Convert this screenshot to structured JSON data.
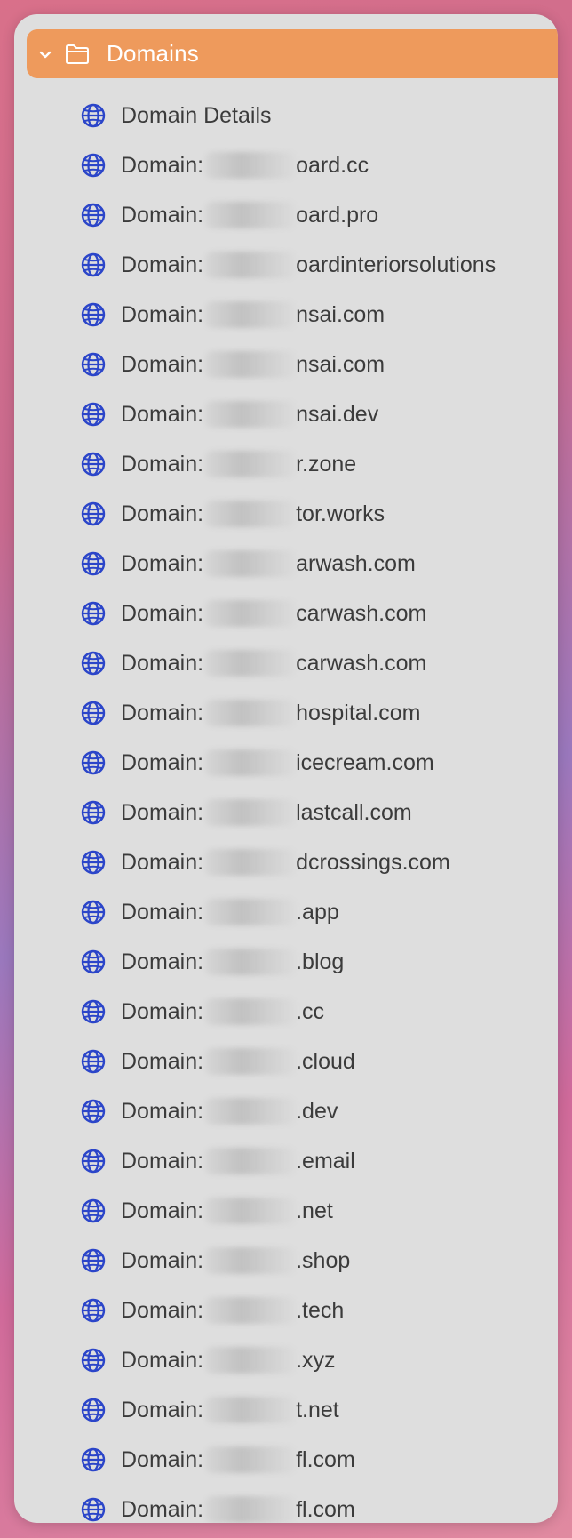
{
  "sidebar": {
    "folder": {
      "label": "Domains",
      "expanded": true,
      "icon": "folder-icon",
      "chevron_icon": "chevron-down-icon",
      "accent_color": "#ee9a5c"
    },
    "item_icon": "globe-icon",
    "icon_color": "#2b45c9",
    "items": [
      {
        "prefix": "Domain Details",
        "suffix": "",
        "redacted": false
      },
      {
        "prefix": "Domain:",
        "suffix": "oard.cc",
        "redacted": true
      },
      {
        "prefix": "Domain:",
        "suffix": "oard.pro",
        "redacted": true
      },
      {
        "prefix": "Domain:",
        "suffix": "oardinteriorsolutions",
        "redacted": true
      },
      {
        "prefix": "Domain:",
        "suffix": "nsai.com",
        "redacted": true
      },
      {
        "prefix": "Domain:",
        "suffix": "nsai.com",
        "redacted": true
      },
      {
        "prefix": "Domain:",
        "suffix": "nsai.dev",
        "redacted": true
      },
      {
        "prefix": "Domain:",
        "suffix": "r.zone",
        "redacted": true
      },
      {
        "prefix": "Domain:",
        "suffix": "tor.works",
        "redacted": true
      },
      {
        "prefix": "Domain:",
        "suffix": "arwash.com",
        "redacted": true
      },
      {
        "prefix": "Domain:",
        "suffix": "carwash.com",
        "redacted": true
      },
      {
        "prefix": "Domain:",
        "suffix": "carwash.com",
        "redacted": true
      },
      {
        "prefix": "Domain:",
        "suffix": "hospital.com",
        "redacted": true
      },
      {
        "prefix": "Domain:",
        "suffix": "icecream.com",
        "redacted": true
      },
      {
        "prefix": "Domain:",
        "suffix": "lastcall.com",
        "redacted": true
      },
      {
        "prefix": "Domain:",
        "suffix": "dcrossings.com",
        "redacted": true
      },
      {
        "prefix": "Domain:",
        "suffix": ".app",
        "redacted": true
      },
      {
        "prefix": "Domain:",
        "suffix": ".blog",
        "redacted": true
      },
      {
        "prefix": "Domain:",
        "suffix": ".cc",
        "redacted": true
      },
      {
        "prefix": "Domain:",
        "suffix": ".cloud",
        "redacted": true
      },
      {
        "prefix": "Domain:",
        "suffix": ".dev",
        "redacted": true
      },
      {
        "prefix": "Domain:",
        "suffix": ".email",
        "redacted": true
      },
      {
        "prefix": "Domain:",
        "suffix": ".net",
        "redacted": true
      },
      {
        "prefix": "Domain:",
        "suffix": ".shop",
        "redacted": true
      },
      {
        "prefix": "Domain:",
        "suffix": ".tech",
        "redacted": true
      },
      {
        "prefix": "Domain:",
        "suffix": ".xyz",
        "redacted": true
      },
      {
        "prefix": "Domain:",
        "suffix": "t.net",
        "redacted": true
      },
      {
        "prefix": "Domain:",
        "suffix": "fl.com",
        "redacted": true
      },
      {
        "prefix": "Domain:",
        "suffix": "fl.com",
        "redacted": true
      }
    ]
  }
}
